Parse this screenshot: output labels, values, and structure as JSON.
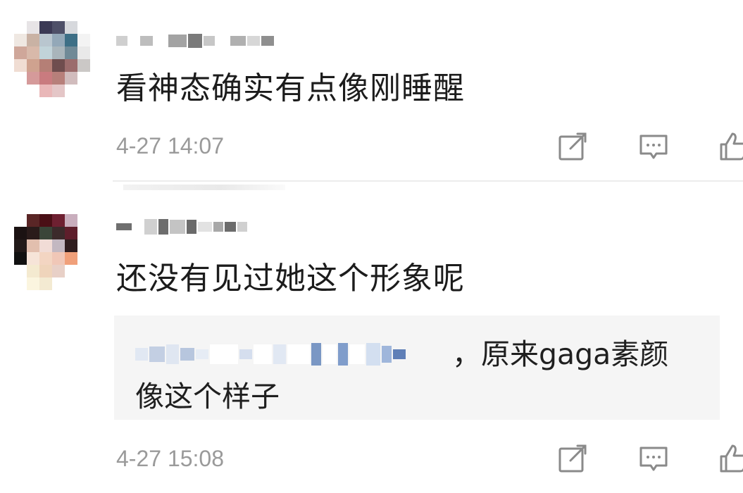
{
  "comments": [
    {
      "text": "看神态确实有点像刚睡醒",
      "time": "4-27 14:07",
      "avatar_icon": "pixelated-avatar",
      "actions": [
        "share-icon",
        "comment-icon",
        "like-icon"
      ]
    },
    {
      "text": "还没有见过她这个形象呢",
      "time": "4-27 15:08",
      "avatar_icon": "pixelated-avatar",
      "actions": [
        "share-icon",
        "comment-icon",
        "like-icon"
      ],
      "reply": {
        "separator": "，",
        "line1_text": "原来gaga素颜",
        "line2_text": "像这个样子"
      }
    }
  ],
  "colors": {
    "text": "#1c1c1c",
    "muted": "#9a9a9a",
    "icon": "#8a8a8a",
    "reply_background": "#f5f5f5"
  }
}
